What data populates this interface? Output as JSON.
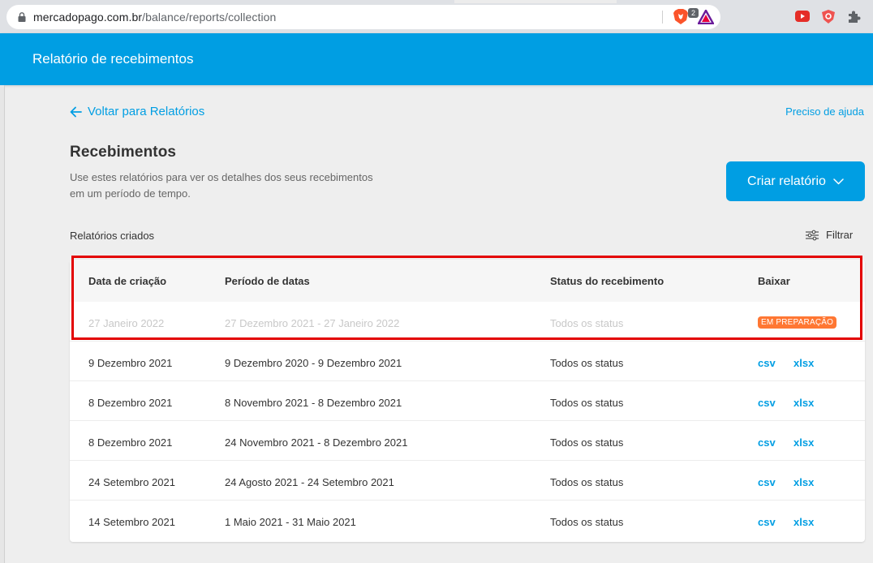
{
  "browser": {
    "url_domain": "mercadopago.com.br",
    "url_path": "/balance/reports/collection",
    "shield_count": "2"
  },
  "header": {
    "title": "Relatório de recebimentos"
  },
  "top": {
    "back_label": "Voltar para Relatórios",
    "help_label": "Preciso de ajuda",
    "title": "Recebimentos",
    "description_line1": "Use estes relatórios para ver os detalhes dos seus recebimentos",
    "description_line2": "em um período de tempo.",
    "create_button": "Criar relatório",
    "section_label": "Relatórios criados",
    "filter_label": "Filtrar"
  },
  "table": {
    "headers": [
      "Data de criação",
      "Período de datas",
      "Status do recebimento",
      "Baixar"
    ],
    "pending_row": {
      "created": "27 Janeiro 2022",
      "period": "27 Dezembro 2021 - 27 Janeiro 2022",
      "status": "Todos os status",
      "badge": "EM PREPARAÇÃO"
    },
    "rows": [
      {
        "created": "9 Dezembro 2021",
        "period": "9 Dezembro 2020 - 9 Dezembro 2021",
        "status": "Todos os status",
        "csv": "csv",
        "xlsx": "xlsx"
      },
      {
        "created": "8 Dezembro 2021",
        "period": "8 Novembro 2021 - 8 Dezembro 2021",
        "status": "Todos os status",
        "csv": "csv",
        "xlsx": "xlsx"
      },
      {
        "created": "8 Dezembro 2021",
        "period": "24 Novembro 2021 - 8 Dezembro 2021",
        "status": "Todos os status",
        "csv": "csv",
        "xlsx": "xlsx"
      },
      {
        "created": "24 Setembro 2021",
        "period": "24 Agosto 2021 - 24 Setembro 2021",
        "status": "Todos os status",
        "csv": "csv",
        "xlsx": "xlsx"
      },
      {
        "created": "14 Setembro 2021",
        "period": "1 Maio 2021 - 31 Maio 2021",
        "status": "Todos os status",
        "csv": "csv",
        "xlsx": "xlsx"
      }
    ]
  },
  "colors": {
    "brand_blue": "#009ee3",
    "badge_orange": "#ff7733",
    "highlight_red": "#e30000"
  }
}
